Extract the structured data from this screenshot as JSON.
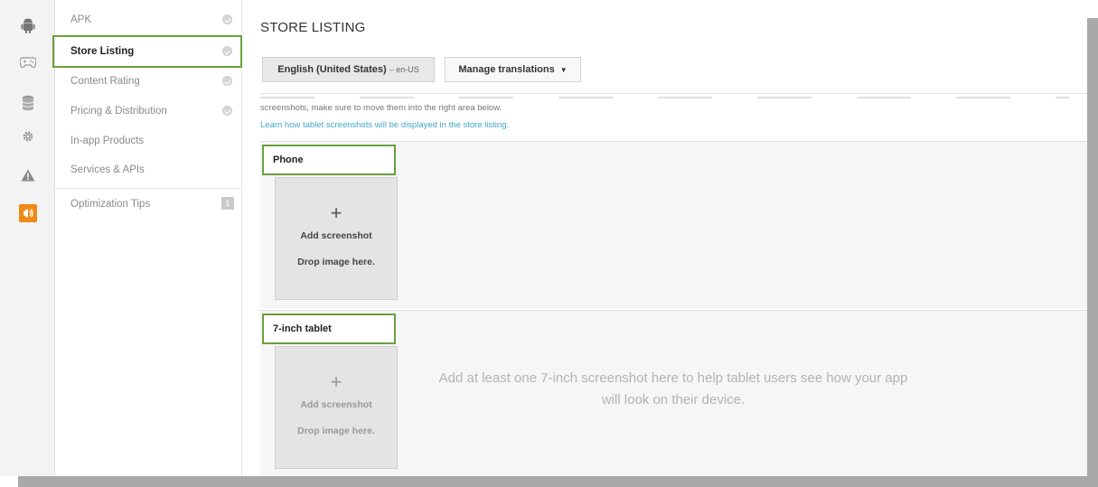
{
  "rail": {
    "icons": [
      "android-icon",
      "gamepad-icon",
      "database-icon",
      "gear-icon",
      "warning-icon",
      "tips-icon"
    ]
  },
  "nav": {
    "items": [
      {
        "label": "APK"
      },
      {
        "label": "Store Listing"
      },
      {
        "label": "Content Rating"
      },
      {
        "label": "Pricing & Distribution"
      },
      {
        "label": "In-app Products"
      },
      {
        "label": "Services & APIs"
      },
      {
        "label": "Optimization Tips",
        "badge": "1"
      }
    ]
  },
  "main": {
    "title": "STORE LISTING",
    "language_button": {
      "label": "English (United States)",
      "code": "– en-US"
    },
    "manage_button": {
      "label": "Manage translations",
      "caret": "▼"
    },
    "hint": "screenshots, make sure to move them into the right area below.",
    "hint_link": "Learn how tablet screenshots will be displayed in the store listing.",
    "phone": {
      "label": "Phone",
      "plus": "+",
      "add": "Add screenshot",
      "drop": "Drop image here."
    },
    "tablet": {
      "label": "7-inch tablet",
      "plus": "+",
      "add": "Add screenshot",
      "drop": "Drop image here.",
      "message": "Add at least one 7-inch screenshot here to help tablet users see how your app will look on their device."
    }
  },
  "colors": {
    "highlight": "#6aa03a",
    "accent": "#ef8a14",
    "link": "#3fa6c8"
  }
}
